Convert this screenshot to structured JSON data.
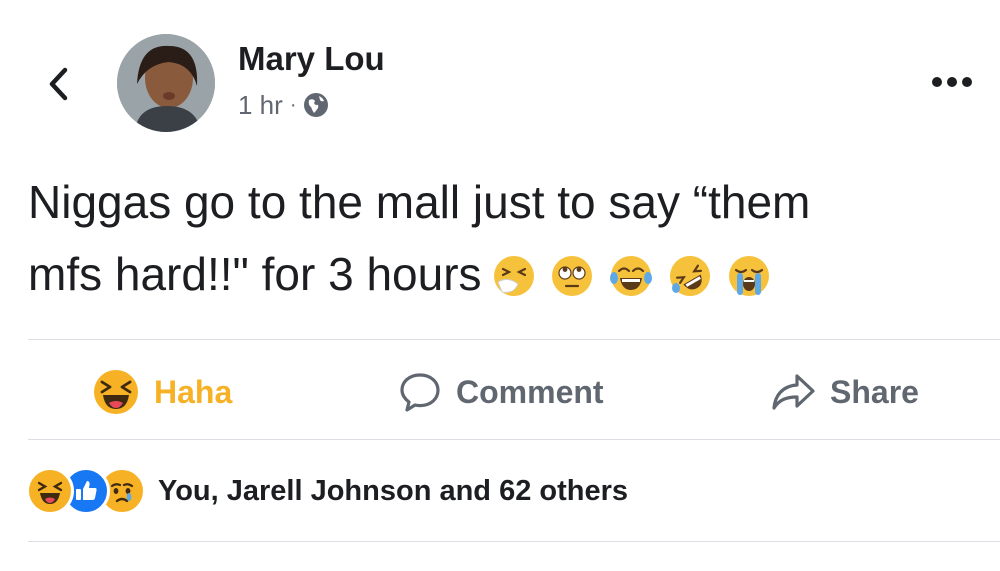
{
  "post": {
    "author": "Mary Lou",
    "timestamp": "1 hr",
    "separator": "·",
    "privacy_icon": "globe-icon",
    "text_line1": "Niggas go to the mall just to say “them",
    "text_line2": "mfs hard!!\" for 3 hours",
    "emojis": [
      "sneezing-face-icon",
      "face-with-rolling-eyes-icon",
      "face-with-tears-of-joy-icon",
      "rolling-on-the-floor-laughing-icon",
      "loudly-crying-face-icon"
    ]
  },
  "actions": {
    "haha_label": "Haha",
    "comment_label": "Comment",
    "share_label": "Share"
  },
  "reactions": {
    "icons": [
      "haha-reaction-icon",
      "like-reaction-icon",
      "sad-reaction-icon"
    ],
    "summary": "You, Jarell Johnson and 62 others"
  },
  "colors": {
    "haha_active": "#f7b125",
    "like_blue": "#1877f2",
    "secondary_text": "#606770",
    "divider": "#dadde1"
  }
}
